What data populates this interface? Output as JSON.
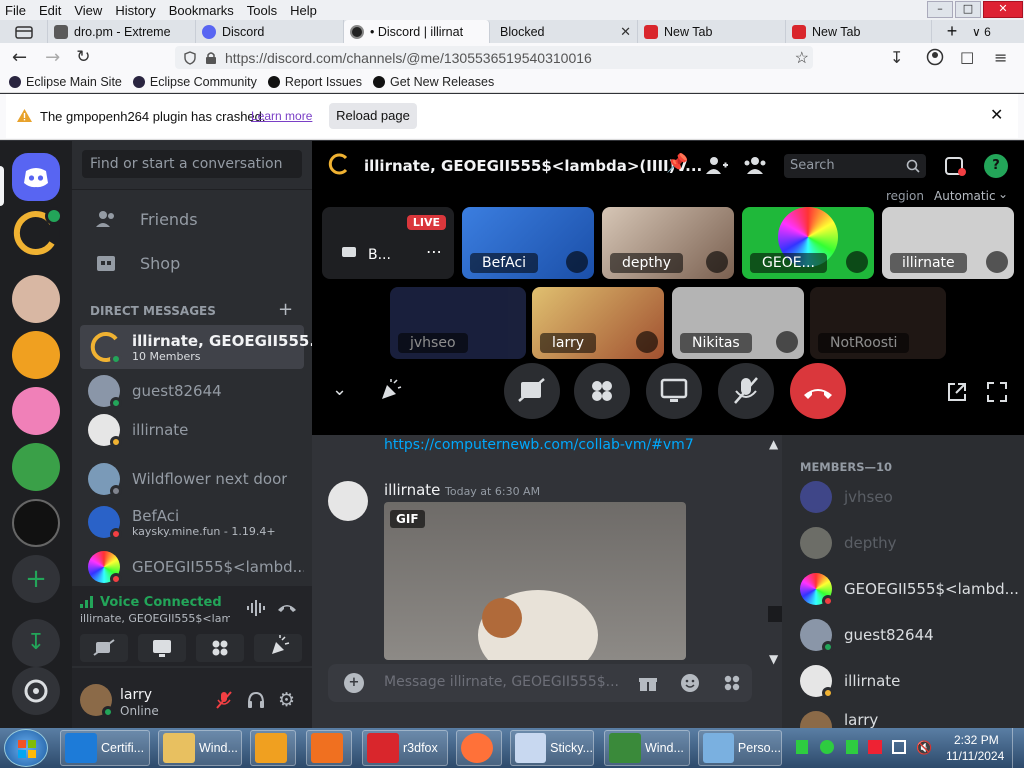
{
  "browser": {
    "menu": [
      "File",
      "Edit",
      "View",
      "History",
      "Bookmarks",
      "Tools",
      "Help"
    ],
    "tabs": [
      {
        "title": "dro.pm - Extreme"
      },
      {
        "title": "Discord"
      },
      {
        "title": "• Discord | illirnat"
      },
      {
        "title": "Blocked"
      },
      {
        "title": "New Tab"
      },
      {
        "title": "New Tab"
      }
    ],
    "tab_count": "6",
    "url": "https://discord.com/channels/@me/1305536519540310016",
    "bookmarks": [
      "Eclipse Main Site",
      "Eclipse Community",
      "Report Issues",
      "Get New Releases"
    ],
    "notification": {
      "text": "The gmpopenh264 plugin has crashed.",
      "link": "Learn more",
      "button": "Reload page"
    }
  },
  "discord": {
    "search_placeholder": "Find or start a conversation",
    "nav": [
      "Friends",
      "Shop"
    ],
    "dm_header": "DIRECT MESSAGES",
    "dms": [
      {
        "name": "illirnate, GEOEGII555...",
        "sub": "10 Members"
      },
      {
        "name": "guest82644",
        "sub": ""
      },
      {
        "name": "illirnate",
        "sub": ""
      },
      {
        "name": "Wildflower next door",
        "sub": ""
      },
      {
        "name": "BefAci",
        "sub": "kaysky.mine.fun - 1.19.4+"
      },
      {
        "name": "GEOEGII555$<lambd...",
        "sub": ""
      }
    ],
    "voice": {
      "status": "Voice Connected",
      "channel": "illirnate, GEOEGII555$<lam..."
    },
    "user": {
      "name": "larry",
      "status": "Online"
    },
    "call": {
      "title": "illirnate, GEOEGII555$<lambda>(IIII)V...",
      "search_placeholder": "Search",
      "region_label": "region",
      "region_value": "Automatic",
      "live_badge": "LIVE",
      "stream_label": "B...",
      "tiles_row1": [
        "BefAci",
        "depthy",
        "GEOE...",
        "illirnate"
      ],
      "tiles_row2": [
        "jvhseo",
        "larry",
        "Nikitas",
        "NotRoosti"
      ]
    },
    "chat": {
      "link": "https://computernewb.com/collab-vm/#vm7",
      "author": "illirnate",
      "time": "Today at 6:30 AM",
      "gif_badge": "GIF",
      "input_placeholder": "Message illirnate, GEOEGII555$..."
    },
    "members_header": "MEMBERS—10",
    "members": [
      "jvhseo",
      "depthy",
      "GEOEGII555$<lambd...",
      "guest82644",
      "illirnate",
      "larry"
    ],
    "colors": {
      "online": "#23a559",
      "dnd": "#f23f43",
      "accent": "#5865f2",
      "hangup": "#da373c"
    }
  },
  "taskbar": {
    "items": [
      "Certifi...",
      "Wind...",
      "",
      "",
      "r3dfox",
      "",
      "Sticky...",
      "Wind...",
      "Perso..."
    ],
    "time": "2:32 PM",
    "date": "11/11/2024"
  }
}
